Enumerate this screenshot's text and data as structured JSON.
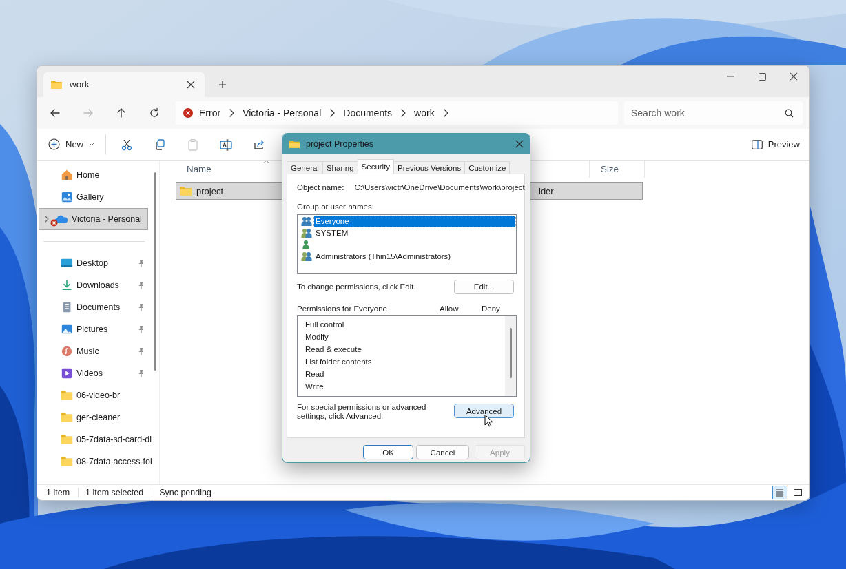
{
  "explorer": {
    "tabs": [
      {
        "title": "work",
        "selected": true
      }
    ],
    "nav": [
      {
        "kind": "back",
        "disabled": false
      },
      {
        "kind": "forward",
        "disabled": true
      },
      {
        "kind": "up",
        "disabled": false
      },
      {
        "kind": "refresh",
        "disabled": false
      }
    ],
    "breadcrumb": [
      {
        "label": "Error",
        "kind": "error"
      },
      {
        "label": "Victoria - Personal",
        "kind": "folder"
      },
      {
        "label": "Documents",
        "kind": "folder"
      },
      {
        "label": "work",
        "kind": "folder"
      }
    ],
    "search": {
      "placeholder": "Search work"
    },
    "toolbar": {
      "new_label": "New",
      "actions": [
        {
          "kind": "cut",
          "disabled": false
        },
        {
          "kind": "copy",
          "disabled": false
        },
        {
          "kind": "paste",
          "disabled": true
        },
        {
          "kind": "rename",
          "disabled": false
        },
        {
          "kind": "share",
          "disabled": false
        }
      ],
      "preview_label": "Preview"
    },
    "sidebar": {
      "locations": [
        {
          "kind": "home",
          "label": "Home",
          "selected": false,
          "sync_error": false
        },
        {
          "kind": "gallery",
          "label": "Gallery",
          "selected": false,
          "sync_error": false
        },
        {
          "kind": "cloud",
          "label": "Victoria - Personal",
          "selected": true,
          "sync_error": true
        }
      ],
      "quick_access": [
        {
          "kind": "desktop",
          "label": "Desktop",
          "pinned": true
        },
        {
          "kind": "downloads",
          "label": "Downloads",
          "pinned": true
        },
        {
          "kind": "documents",
          "label": "Documents",
          "pinned": true
        },
        {
          "kind": "pictures",
          "label": "Pictures",
          "pinned": true
        },
        {
          "kind": "music",
          "label": "Music",
          "pinned": true
        },
        {
          "kind": "videos",
          "label": "Videos",
          "pinned": true
        },
        {
          "kind": "folder",
          "label": "06-video-br",
          "pinned": false
        },
        {
          "kind": "folder",
          "label": "ger-cleaner",
          "pinned": false
        },
        {
          "kind": "folder",
          "label": "05-7data-sd-card-di",
          "pinned": false
        },
        {
          "kind": "folder",
          "label": "08-7data-access-fol",
          "pinned": false
        }
      ]
    },
    "columns": [
      {
        "label": "Name",
        "sorted": true
      },
      {
        "label": "Size",
        "sorted": false
      }
    ],
    "rows": [
      {
        "name": "project",
        "type": "lder",
        "selected": true
      }
    ],
    "status_bar": {
      "items": [
        "1 item",
        "1 item selected",
        "Sync pending"
      ],
      "views": [
        {
          "kind": "details",
          "selected": true
        },
        {
          "kind": "tiles",
          "selected": false
        }
      ]
    }
  },
  "dialog": {
    "title": "project Properties",
    "tabs": [
      {
        "label": "General",
        "selected": false
      },
      {
        "label": "Sharing",
        "selected": false
      },
      {
        "label": "Security",
        "selected": true
      },
      {
        "label": "Previous Versions",
        "selected": false
      },
      {
        "label": "Customize",
        "selected": false
      }
    ],
    "object_name": {
      "label": "Object name:",
      "value": "C:\\Users\\victr\\OneDrive\\Documents\\work\\project"
    },
    "groups_label": "Group or user names:",
    "groups": [
      {
        "kind": "group",
        "name": "Everyone",
        "selected": true
      },
      {
        "kind": "group",
        "name": "SYSTEM",
        "selected": false
      },
      {
        "kind": "user",
        "selected": false
      },
      {
        "kind": "group",
        "name": "Administrators (Thin15\\Administrators)",
        "selected": false
      }
    ],
    "edit_note": "To change permissions, click Edit.",
    "edit_button": "Edit...",
    "permissions_label": "Permissions for Everyone",
    "allow_label": "Allow",
    "deny_label": "Deny",
    "permissions": [
      "Full control",
      "Modify",
      "Read & execute",
      "List folder contents",
      "Read",
      "Write"
    ],
    "advanced_note": "For special permissions or advanced settings, click Advanced.",
    "advanced_button": "Advanced",
    "buttons": [
      {
        "label": "OK",
        "kind": "default",
        "disabled": false
      },
      {
        "label": "Cancel",
        "kind": "normal",
        "disabled": false
      },
      {
        "label": "Apply",
        "kind": "normal",
        "disabled": true
      }
    ]
  }
}
